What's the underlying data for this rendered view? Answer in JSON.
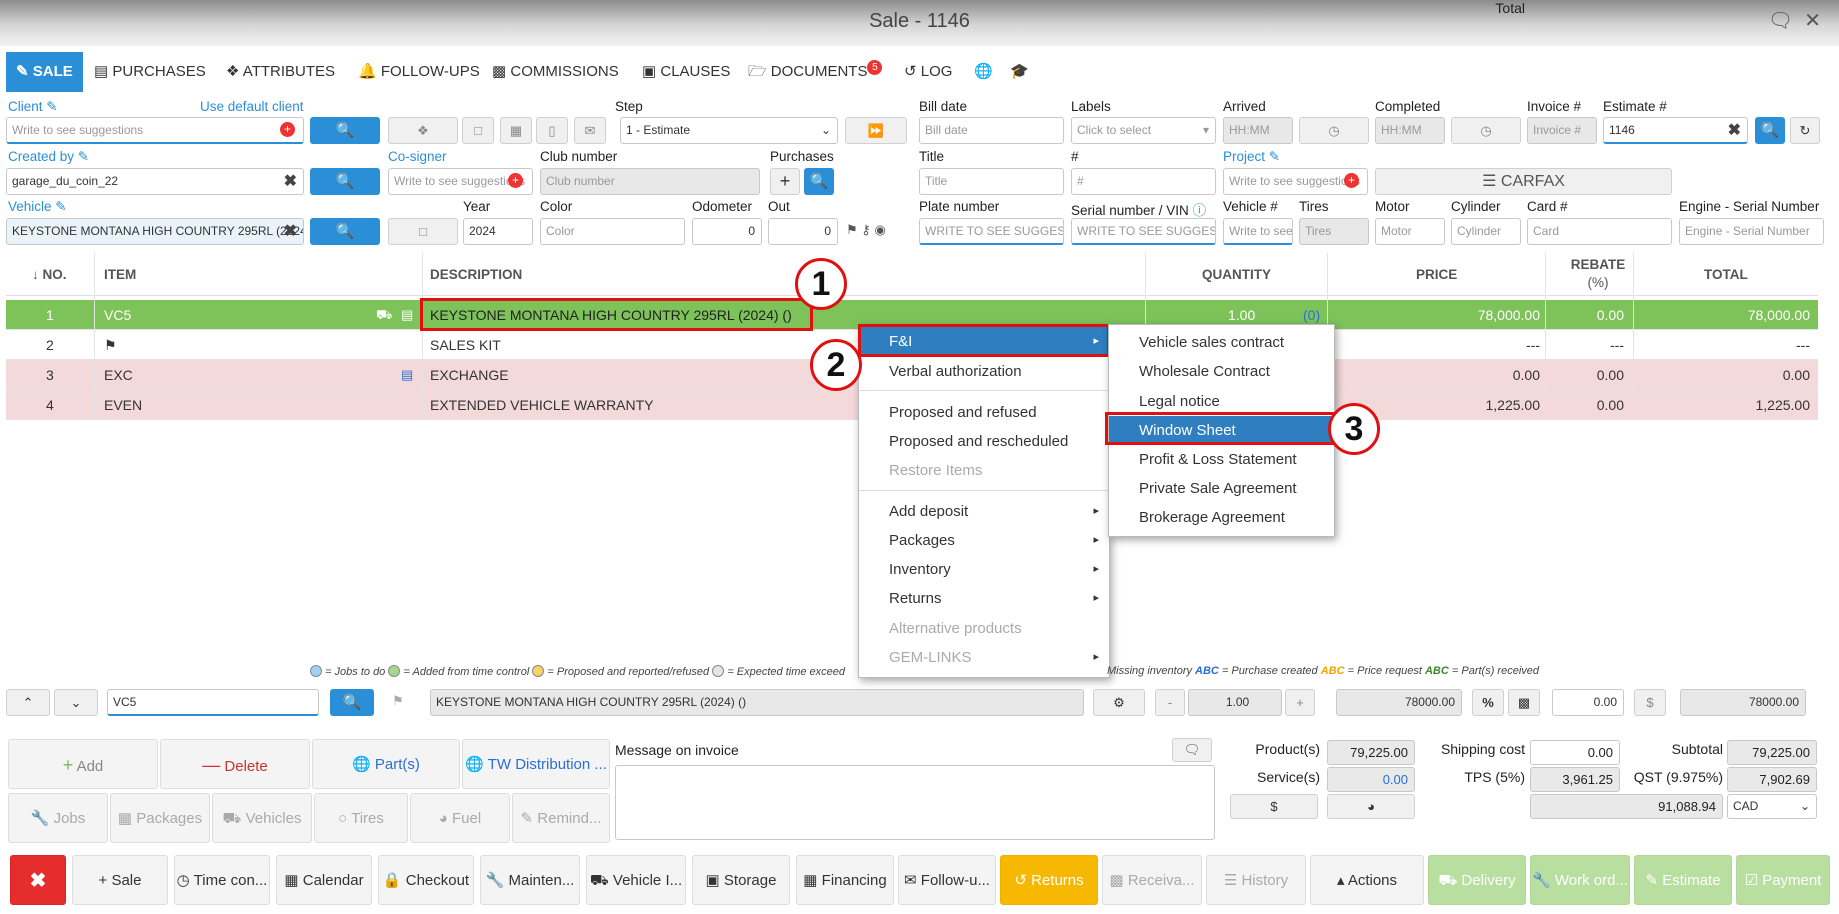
{
  "window": {
    "title": "Sale - 1146"
  },
  "tabs": [
    {
      "label": "SALE"
    },
    {
      "label": "PURCHASES"
    },
    {
      "label": "ATTRIBUTES"
    },
    {
      "label": "FOLLOW-UPS"
    },
    {
      "label": "COMMISSIONS"
    },
    {
      "label": "CLAUSES"
    },
    {
      "label": "DOCUMENTS",
      "badge": "5"
    },
    {
      "label": "LOG"
    }
  ],
  "form": {
    "client_label": "Client",
    "use_default_client": "Use default client",
    "client_placeholder": "Write to see suggestions",
    "step_label": "Step",
    "step_value": "1 - Estimate",
    "bill_date_label": "Bill date",
    "bill_date_placeholder": "Bill date",
    "labels_label": "Labels",
    "labels_placeholder": "Click to select",
    "arrived_label": "Arrived",
    "arrived_placeholder": "HH:MM",
    "completed_label": "Completed",
    "completed_placeholder": "HH:MM",
    "invoice_label": "Invoice #",
    "invoice_placeholder": "Invoice #",
    "estimate_label": "Estimate #",
    "estimate_value": "1146",
    "created_by_label": "Created by",
    "created_by_value": "garage_du_coin_22",
    "cosigner_label": "Co-signer",
    "cosigner_placeholder": "Write to see suggestions",
    "club_label": "Club number",
    "club_placeholder": "Club number",
    "purchases_label": "Purchases",
    "title_label": "Title",
    "title_placeholder": "Title",
    "num_label": "#",
    "num_placeholder": "#",
    "project_label": "Project",
    "project_placeholder": "Write to see suggestions",
    "carfax": "CARFAX",
    "vehicle_label": "Vehicle",
    "vehicle_value": "KEYSTONE MONTANA HIGH COUNTRY 295RL (2024)",
    "year_label": "Year",
    "year_value": "2024",
    "color_label": "Color",
    "color_placeholder": "Color",
    "odometer_label": "Odometer",
    "odometer_value": "0",
    "out_label": "Out",
    "out_value": "0",
    "plate_label": "Plate number",
    "plate_placeholder": "WRITE TO SEE SUGGESTIONS",
    "vin_label": "Serial number / VIN",
    "vin_placeholder": "WRITE TO SEE SUGGESTIONS",
    "vehnum_label": "Vehicle #",
    "vehnum_placeholder": "Write to see suggestions",
    "tires_label": "Tires",
    "tires_placeholder": "Tires",
    "motor_label": "Motor",
    "motor_placeholder": "Motor",
    "cylinder_label": "Cylinder",
    "cylinder_placeholder": "Cylinder",
    "card_label": "Card #",
    "card_placeholder": "Card",
    "engine_label": "Engine - Serial Number",
    "engine_placeholder": "Engine - Serial Number"
  },
  "table": {
    "headers": {
      "no": "↓ NO.",
      "item": "ITEM",
      "description": "DESCRIPTION",
      "quantity": "QUANTITY",
      "price": "PRICE",
      "rebate": "REBATE",
      "rebate_unit": "(%)",
      "total": "TOTAL"
    },
    "rows": [
      {
        "no": "1",
        "item": "VC5",
        "description": "KEYSTONE MONTANA HIGH COUNTRY 295RL (2024) ()",
        "quantity": "1.00",
        "qty_extra": "(0)",
        "price": "78,000.00",
        "rebate": "0.00",
        "total": "78,000.00"
      },
      {
        "no": "2",
        "item": "",
        "description": "SALES KIT",
        "quantity": "",
        "qty_extra": "",
        "price": "---",
        "rebate": "---",
        "total": "---"
      },
      {
        "no": "3",
        "item": "EXC",
        "description": "EXCHANGE",
        "quantity": "",
        "qty_extra": "",
        "price": "0.00",
        "rebate": "0.00",
        "total": "0.00"
      },
      {
        "no": "4",
        "item": "EVEN",
        "description": "EXTENDED VEHICLE WARRANTY",
        "quantity": "",
        "qty_extra": "",
        "price": "1,225.00",
        "rebate": "0.00",
        "total": "1,225.00"
      }
    ]
  },
  "context_menu": {
    "items": [
      {
        "label": "F&I"
      },
      {
        "label": "Verbal authorization"
      },
      {
        "label": "Proposed and refused"
      },
      {
        "label": "Proposed and rescheduled"
      },
      {
        "label": "Restore Items"
      },
      {
        "label": "Add deposit"
      },
      {
        "label": "Packages"
      },
      {
        "label": "Inventory"
      },
      {
        "label": "Returns"
      },
      {
        "label": "Alternative products"
      },
      {
        "label": "GEM-LINKS"
      }
    ]
  },
  "submenu": {
    "items": [
      {
        "label": "Vehicle sales contract"
      },
      {
        "label": "Wholesale Contract"
      },
      {
        "label": "Legal notice"
      },
      {
        "label": "Window Sheet"
      },
      {
        "label": "Profit & Loss Statement"
      },
      {
        "label": "Private Sale Agreement"
      },
      {
        "label": "Brokerage Agreement"
      }
    ]
  },
  "callouts": [
    "1",
    "2",
    "3"
  ],
  "legend": {
    "jobs": "= Jobs to do",
    "added": "= Added from time control",
    "proposed": "= Proposed and reported/refused",
    "expected": "= Expected time exceed",
    "missing": "Missing inventory",
    "abc": "ABC",
    "purchase": "= Purchase created",
    "price_req": "= Price request",
    "received": "= Part(s) received"
  },
  "editor": {
    "item_value": "VC5",
    "description_value": "KEYSTONE MONTANA HIGH COUNTRY 295RL (2024) ()",
    "qty_value": "1.00",
    "price_value": "78000.00",
    "rebate_value": "0.00",
    "total_value": "78000.00"
  },
  "actions": {
    "add": "Add",
    "delete": "Delete",
    "parts": "Part(s)",
    "tw": "TW Distribution ...",
    "jobs": "Jobs",
    "packages": "Packages",
    "vehicles": "Vehicles",
    "tires": "Tires",
    "fuel": "Fuel",
    "remind": "Remind..."
  },
  "message": {
    "label": "Message on invoice"
  },
  "totals": {
    "products_label": "Product(s)",
    "products": "79,225.00",
    "services_label": "Service(s)",
    "services": "0.00",
    "shipping_label": "Shipping cost",
    "shipping": "0.00",
    "tps_label": "TPS (5%)",
    "tps": "3,961.25",
    "subtotal_label": "Subtotal",
    "subtotal": "79,225.00",
    "qst_label": "QST (9.975%)",
    "qst": "7,902.69",
    "total_label": "Total",
    "total": "91,088.94",
    "currency": "CAD"
  },
  "bottom": {
    "sale": "Sale",
    "time": "Time con...",
    "calendar": "Calendar",
    "checkout": "Checkout",
    "maint": "Mainten...",
    "vehicle": "Vehicle I...",
    "storage": "Storage",
    "financing": "Financing",
    "followup": "Follow-u...",
    "returns": "Returns",
    "receiva": "Receiva...",
    "history": "History",
    "actions": "Actions",
    "delivery": "Delivery",
    "workord": "Work ord...",
    "estimate": "Estimate",
    "payment": "Payment"
  }
}
